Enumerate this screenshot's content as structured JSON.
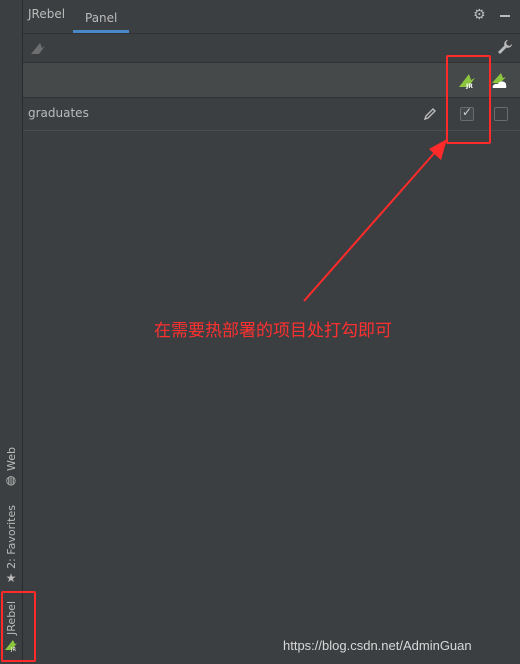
{
  "header": {
    "title": "JRebel",
    "active_tab": "Panel"
  },
  "project_row": {
    "name": "graduates",
    "jrebel_checked": true,
    "remote_checked": false
  },
  "annotation": {
    "text": "在需要热部署的项目处打勾即可",
    "color": "#ff2a2a"
  },
  "left_stripe": {
    "items": [
      "Web",
      "2: Favorites",
      "JRebel"
    ]
  },
  "watermark": "https://blog.csdn.net/AdminGuan",
  "colors": {
    "background": "#3c3f41",
    "accent": "#4a88c7",
    "jrebel_green": "#8cc63f",
    "annotation_red": "#ff2a2a"
  },
  "icons": {
    "settings": "gear-icon",
    "minimize": "minimize-icon",
    "toolbar_left": "jrebel-gray-icon",
    "toolbar_right": "wrench-icon",
    "edit": "pencil-icon",
    "jrebel_column": "jrebel-icon",
    "remote_column": "remote-server-icon",
    "web": "globe-icon",
    "favorites": "star-icon"
  }
}
